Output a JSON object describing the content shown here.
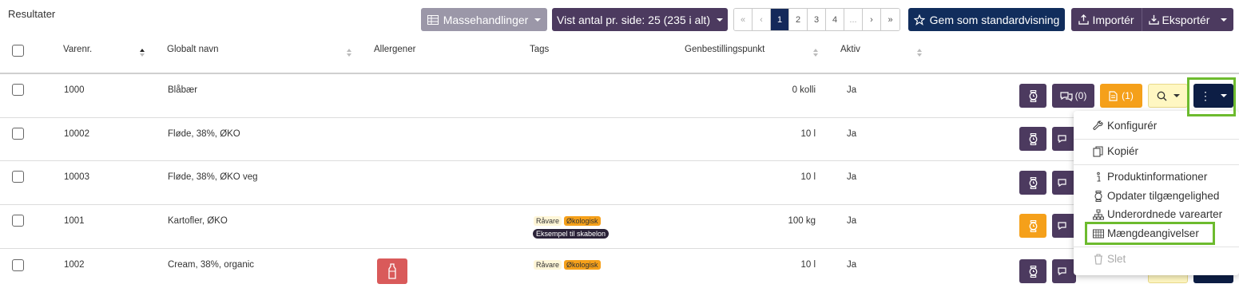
{
  "title": "Resultater",
  "toolbar": {
    "mass_actions": "Massehandlinger",
    "per_page": "Vist antal pr. side: 25 (235 i alt)",
    "pager": [
      "«",
      "‹",
      "1",
      "2",
      "3",
      "4",
      "...",
      "›",
      "»"
    ],
    "pager_active": "1",
    "save_default": "Gem som standardvisning",
    "import": "Importér",
    "export": "Eksportér"
  },
  "columns": {
    "varenr": "Varenr.",
    "name": "Globalt navn",
    "allergens": "Allergener",
    "tags": "Tags",
    "reorder": "Genbestillingspunkt",
    "active": "Aktiv"
  },
  "rows": [
    {
      "varenr": "1000",
      "name": "Blåbær",
      "reorder": "0 kolli",
      "active": "Ja",
      "comments": "(0)",
      "docs": "(1)"
    },
    {
      "varenr": "10002",
      "name": "Fløde, 38%, ØKO",
      "reorder": "10 l",
      "active": "Ja"
    },
    {
      "varenr": "10003",
      "name": "Fløde, 38%, ØKO veg",
      "reorder": "10 l",
      "active": "Ja"
    },
    {
      "varenr": "1001",
      "name": "Kartofler, ØKO",
      "reorder": "100 kg",
      "active": "Ja",
      "tags": [
        "Råvare",
        "Økologisk"
      ],
      "tag2": "Eksempel til skabelon"
    },
    {
      "varenr": "1002",
      "name": "Cream, 38%, organic",
      "reorder": "10 l",
      "active": "Ja",
      "tags": [
        "Råvare",
        "Økologisk"
      ]
    }
  ],
  "menu": {
    "configure": "Konfigurér",
    "copy": "Kopiér",
    "product_info": "Produktinformationer",
    "update_availability": "Opdater tilgængelighed",
    "sub_types": "Underordnede varearter",
    "quantities": "Mængdeangivelser",
    "delete": "Slet"
  },
  "colors": {
    "purple": "#4c3a5f",
    "navy": "#0d1e45",
    "orange": "#f5a01a",
    "highlight": "#6dbb2e"
  }
}
